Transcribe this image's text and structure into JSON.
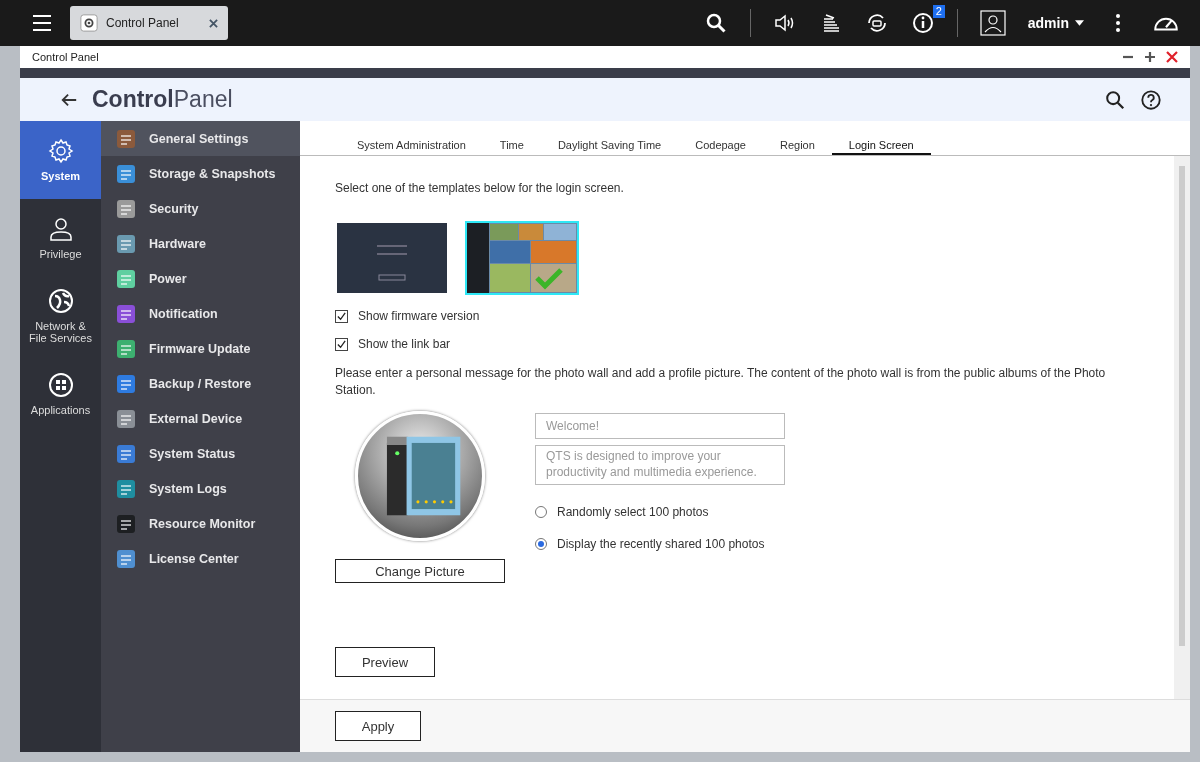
{
  "taskbar": {
    "tab": {
      "label": "Control Panel"
    },
    "notification_count": "2",
    "user": "admin"
  },
  "window": {
    "title": "Control Panel",
    "header_bold": "Control",
    "header_light": "Panel"
  },
  "categories": [
    {
      "label": "System",
      "selected": true
    },
    {
      "label": "Privilege",
      "selected": false
    },
    {
      "label": "Network &\nFile Services",
      "selected": false
    },
    {
      "label": "Applications",
      "selected": false
    }
  ],
  "menu": [
    {
      "label": "General Settings",
      "selected": true
    },
    {
      "label": "Storage & Snapshots",
      "selected": false
    },
    {
      "label": "Security",
      "selected": false
    },
    {
      "label": "Hardware",
      "selected": false
    },
    {
      "label": "Power",
      "selected": false
    },
    {
      "label": "Notification",
      "selected": false
    },
    {
      "label": "Firmware Update",
      "selected": false
    },
    {
      "label": "Backup / Restore",
      "selected": false
    },
    {
      "label": "External Device",
      "selected": false
    },
    {
      "label": "System Status",
      "selected": false
    },
    {
      "label": "System Logs",
      "selected": false
    },
    {
      "label": "Resource Monitor",
      "selected": false
    },
    {
      "label": "License Center",
      "selected": false
    }
  ],
  "tabs": [
    {
      "label": "System Administration",
      "selected": false
    },
    {
      "label": "Time",
      "selected": false
    },
    {
      "label": "Daylight Saving Time",
      "selected": false
    },
    {
      "label": "Codepage",
      "selected": false
    },
    {
      "label": "Region",
      "selected": false
    },
    {
      "label": "Login Screen",
      "selected": true
    }
  ],
  "intro": "Select one of the templates below for the login screen.",
  "templates": [
    {
      "kind": "classic",
      "selected": false
    },
    {
      "kind": "photo-wall",
      "selected": true
    }
  ],
  "options": [
    {
      "label": "Show firmware version",
      "checked": true
    },
    {
      "label": "Show the link bar",
      "checked": true
    }
  ],
  "message_intro": "Please enter a personal message for the photo wall and add a profile picture. The content of the photo wall is from the public albums of the Photo Station.",
  "title_field": {
    "placeholder": "Welcome!"
  },
  "message_field": {
    "placeholder": "QTS is designed to improve your productivity and multimedia experience."
  },
  "change_picture": "Change Picture",
  "photo_source": [
    {
      "label": "Randomly select 100 photos",
      "selected": false
    },
    {
      "label": "Display the recently shared 100 photos",
      "selected": true
    }
  ],
  "preview": "Preview",
  "apply": "Apply"
}
